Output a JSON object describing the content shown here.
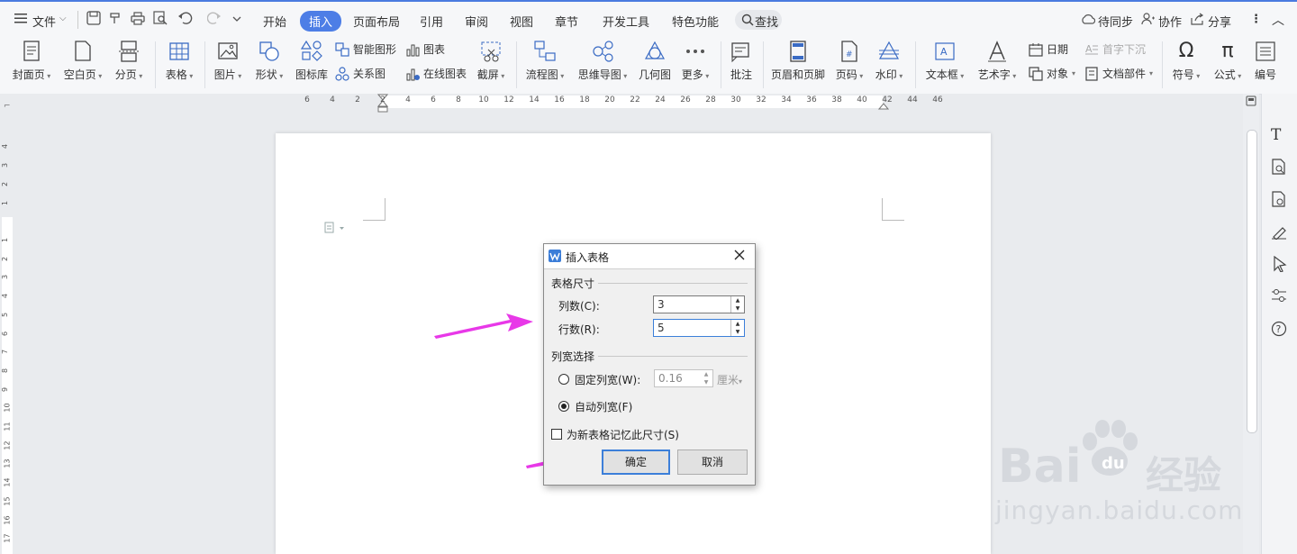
{
  "menubar": {
    "file_label": "文件",
    "tabs": [
      "开始",
      "插入",
      "页面布局",
      "引用",
      "审阅",
      "视图",
      "章节",
      "开发工具",
      "特色功能"
    ],
    "active_tab": "插入",
    "search_label": "查找",
    "right": [
      "待同步",
      "协作",
      "分享"
    ]
  },
  "ribbon": {
    "big": [
      "封面页",
      "空白页",
      "分页",
      "表格",
      "图片",
      "形状",
      "图标库",
      "流程图",
      "思维导图",
      "几何图",
      "更多",
      "批注",
      "页眉和页脚",
      "页码",
      "水印",
      "文本框",
      "艺术字",
      "符号",
      "公式",
      "编号"
    ],
    "small": [
      "智能图形",
      "关系图",
      "图表",
      "在线图表",
      "截屏",
      "日期",
      "对象",
      "首字下沉",
      "文档部件"
    ]
  },
  "ruler": {
    "top_ticks": [
      "6",
      "4",
      "2",
      "2",
      "4",
      "6",
      "8",
      "10",
      "12",
      "14",
      "16",
      "18",
      "20",
      "22",
      "24",
      "26",
      "28",
      "30",
      "32",
      "34",
      "36",
      "38",
      "40",
      "42",
      "44",
      "46"
    ],
    "left_ticks": [
      "4",
      "3",
      "2",
      "1",
      "1",
      "2",
      "3",
      "4",
      "5",
      "6",
      "7",
      "8",
      "9",
      "10",
      "11",
      "12",
      "13",
      "14",
      "15",
      "16",
      "17"
    ]
  },
  "dialog": {
    "title": "插入表格",
    "size_group": "表格尺寸",
    "cols_label": "列数(C):",
    "cols_value": "3",
    "rows_label": "行数(R):",
    "rows_value": "5",
    "width_group": "列宽选择",
    "fixed_label": "固定列宽(W):",
    "fixed_value": "0.16",
    "fixed_unit": "厘米",
    "auto_label": "自动列宽(F)",
    "remember_label": "为新表格记忆此尺寸(S)",
    "ok": "确定",
    "cancel": "取消",
    "auto_selected": true
  },
  "watermark": {
    "brand": "Bai",
    "brand_cn": "经验",
    "url": "jingyan.baidu.com"
  },
  "colors": {
    "accent": "#4d7ee6",
    "arrow": "#e838e8"
  }
}
